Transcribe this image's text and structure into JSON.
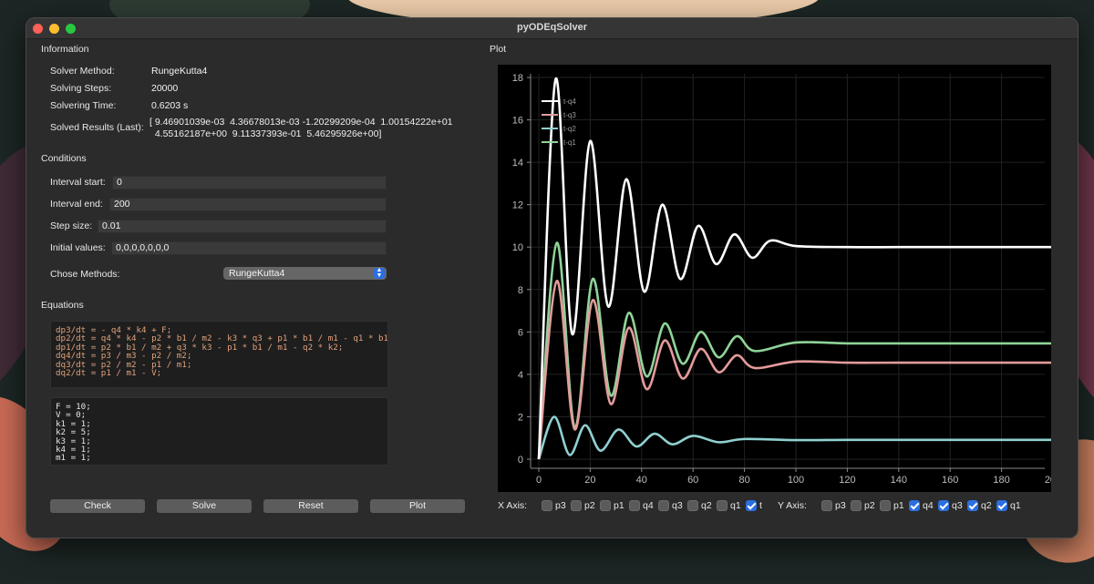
{
  "window": {
    "title": "pyODEqSolver"
  },
  "information": {
    "section_title": "Information",
    "solver_method_label": "Solver Method:",
    "solver_method_value": "RungeKutta4",
    "solving_steps_label": "Solving Steps:",
    "solving_steps_value": "20000",
    "solvering_time_label": "Solvering Time:",
    "solvering_time_value": "0.6203 s",
    "solved_results_label": "Solved Results (Last):",
    "solved_results_line1": "[ 9.46901039e-03  4.36678013e-03 -1.20299209e-04  1.00154222e+01",
    "solved_results_line2": "  4.55162187e+00  9.11337393e-01  5.46295926e+00]"
  },
  "conditions": {
    "section_title": "Conditions",
    "interval_start_label": "Interval start:",
    "interval_start_value": "0",
    "interval_end_label": "Interval end:",
    "interval_end_value": "200",
    "step_size_label": "Step size:",
    "step_size_value": "0.01",
    "initial_values_label": "Initial values:",
    "initial_values_value": "0,0,0,0,0,0,0",
    "chose_methods_label": "Chose Methods:",
    "chose_methods_selected": "RungeKutta4"
  },
  "equations": {
    "section_title": "Equations",
    "equations_text": "dp3/dt = - q4 * k4 + F;\ndp2/dt = q4 * k4 - p2 * b1 / m2 - k3 * q3 + p1 * b1 / m1 - q1 * b1\ndp1/dt = p2 * b1 / m2 + q3 * k3 - p1 * b1 / m1 - q2 * k2;\ndq4/dt = p3 / m3 - p2 / m2;\ndq3/dt = p2 / m2 - p1 / m1;\ndq2/dt = p1 / m1 - V;",
    "params_text": "F = 10;\nV = 0;\nk1 = 1;\nk2 = 5;\nk3 = 1;\nk4 = 1;\nm1 = 1;"
  },
  "buttons": {
    "check": "Check",
    "solve": "Solve",
    "reset": "Reset",
    "plot": "Plot"
  },
  "plot": {
    "section_title": "Plot"
  },
  "x_axis": {
    "label": "X Axis:",
    "options": [
      {
        "name": "p3",
        "checked": false
      },
      {
        "name": "p2",
        "checked": false
      },
      {
        "name": "p1",
        "checked": false
      },
      {
        "name": "q4",
        "checked": false
      },
      {
        "name": "q3",
        "checked": false
      },
      {
        "name": "q2",
        "checked": false
      },
      {
        "name": "q1",
        "checked": false
      },
      {
        "name": "t",
        "checked": true
      }
    ]
  },
  "y_axis": {
    "label": "Y Axis:",
    "options": [
      {
        "name": "p3",
        "checked": false
      },
      {
        "name": "p2",
        "checked": false
      },
      {
        "name": "p1",
        "checked": false
      },
      {
        "name": "q4",
        "checked": true
      },
      {
        "name": "q3",
        "checked": true
      },
      {
        "name": "q2",
        "checked": true
      },
      {
        "name": "q1",
        "checked": true
      }
    ]
  },
  "chart_data": {
    "type": "line",
    "xlim": [
      0,
      200
    ],
    "ylim": [
      0,
      18
    ],
    "xticks": [
      0,
      20,
      40,
      60,
      80,
      100,
      120,
      140,
      160,
      180,
      200
    ],
    "yticks": [
      0,
      2,
      4,
      6,
      8,
      10,
      12,
      14,
      16,
      18
    ],
    "grid": true,
    "legend_position": "top-left",
    "series": [
      {
        "name": "t-q4",
        "color": "#ffffff",
        "x": [
          0,
          6.5,
          13,
          20,
          27,
          34,
          41,
          48,
          55,
          62,
          69,
          76,
          83,
          90,
          100,
          120,
          140,
          160,
          180,
          200
        ],
        "y": [
          0,
          17.9,
          5.9,
          15.0,
          7.2,
          13.2,
          7.9,
          12.0,
          8.5,
          11.0,
          9.2,
          10.6,
          9.5,
          10.3,
          10.05,
          10.0,
          10.0,
          10.0,
          10.0,
          10.0
        ]
      },
      {
        "name": "t-q3",
        "color": "#e39b9b",
        "x": [
          0,
          7,
          14,
          21,
          28,
          35,
          42,
          49,
          56,
          63,
          70,
          77,
          84,
          100,
          120,
          140,
          160,
          180,
          200
        ],
        "y": [
          0,
          8.4,
          1.4,
          7.5,
          2.6,
          6.2,
          3.3,
          5.6,
          3.8,
          5.2,
          4.1,
          4.9,
          4.3,
          4.6,
          4.55,
          4.55,
          4.55,
          4.55,
          4.55
        ]
      },
      {
        "name": "t-q2",
        "color": "#8fd0d0",
        "x": [
          0,
          6,
          12,
          18,
          24,
          31,
          38,
          45,
          52,
          60,
          70,
          80,
          100,
          120,
          140,
          160,
          180,
          200
        ],
        "y": [
          0,
          2.0,
          0.2,
          1.6,
          0.4,
          1.4,
          0.6,
          1.2,
          0.7,
          1.1,
          0.8,
          0.95,
          0.9,
          0.91,
          0.91,
          0.91,
          0.91,
          0.91
        ]
      },
      {
        "name": "t-q1",
        "color": "#8fd498",
        "x": [
          0,
          7,
          14,
          21,
          28,
          35,
          42,
          49,
          56,
          63,
          70,
          77,
          84,
          100,
          120,
          140,
          160,
          180,
          200
        ],
        "y": [
          0,
          10.2,
          1.5,
          8.5,
          3.0,
          6.9,
          3.9,
          6.4,
          4.5,
          6.0,
          4.8,
          5.8,
          5.1,
          5.5,
          5.46,
          5.46,
          5.46,
          5.46,
          5.46
        ]
      }
    ]
  }
}
